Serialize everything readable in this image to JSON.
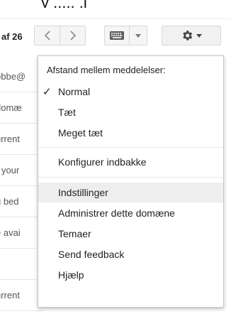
{
  "top_partial_text": "y ...., ,j",
  "toolbar": {
    "page_count": "af 26",
    "prev_icon": "chevron-left",
    "next_icon": "chevron-right",
    "keyboard_icon": "keyboard",
    "dropdown_icon": "caret-down",
    "gear_icon": "gear"
  },
  "list_rows": [
    {
      "text": "obbe@"
    },
    {
      "text": "domæ"
    },
    {
      "text": "urrent"
    },
    {
      "text": "r your"
    },
    {
      "text": "g bed"
    },
    {
      "text": "e avai"
    },
    {
      "text": ""
    },
    {
      "text": "urrent"
    }
  ],
  "menu": {
    "header": "Afstand mellem meddelelser:",
    "density_items": [
      {
        "label": "Normal",
        "checked": true
      },
      {
        "label": "Tæt",
        "checked": false
      },
      {
        "label": "Meget tæt",
        "checked": false
      }
    ],
    "configure": "Konfigurer indbakke",
    "items": [
      {
        "label": "Indstillinger",
        "highlighted": true
      },
      {
        "label": "Administrer dette domæne"
      },
      {
        "label": "Temaer"
      },
      {
        "label": "Send feedback"
      },
      {
        "label": "Hjælp"
      }
    ]
  },
  "colors": {
    "menu_highlight": "#eeeeee",
    "button_bg": "#f5f5f5",
    "border": "#d8d8d8"
  }
}
